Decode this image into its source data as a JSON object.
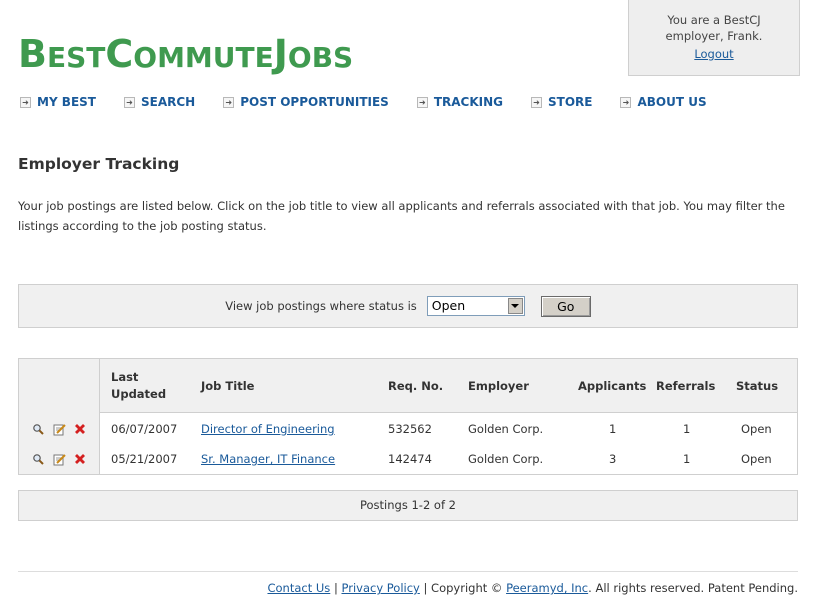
{
  "logo": {
    "text": "BestCommuteJobs"
  },
  "user_box": {
    "line1": "You are a BestCJ",
    "line2": "employer, Frank.",
    "logout": "Logout"
  },
  "nav": [
    {
      "label": "MY BEST"
    },
    {
      "label": "SEARCH"
    },
    {
      "label": "POST OPPORTUNITIES"
    },
    {
      "label": "TRACKING"
    },
    {
      "label": "STORE"
    },
    {
      "label": "ABOUT US"
    }
  ],
  "page_title": "Employer Tracking",
  "intro": "Your job postings are listed below. Click on the job title to view all applicants and referrals associated with that job. You may filter the listings according to the job posting status.",
  "filter": {
    "label": "View job postings where status is",
    "selected": "Open",
    "go": "Go"
  },
  "table": {
    "headers": {
      "last_updated_1": "Last",
      "last_updated_2": "Updated",
      "job_title": "Job Title",
      "req_no": "Req. No.",
      "employer": "Employer",
      "applicants": "Applicants",
      "referrals": "Referrals",
      "status": "Status"
    },
    "rows": [
      {
        "date": "06/07/2007",
        "title": "Director of Engineering",
        "req": "532562",
        "employer": "Golden Corp.",
        "applicants": "1",
        "referrals": "1",
        "status": "Open"
      },
      {
        "date": "05/21/2007",
        "title": "Sr. Manager, IT Finance",
        "req": "142474",
        "employer": "Golden Corp.",
        "applicants": "3",
        "referrals": "1",
        "status": "Open"
      }
    ]
  },
  "pager": "Postings 1-2 of 2",
  "footer": {
    "contact": "Contact Us",
    "sep1": "|",
    "privacy": "Privacy Policy",
    "copyright": "| Copyright ©",
    "company": "Peeramyd, Inc",
    "rest": ". All rights reserved. Patent Pending."
  },
  "colors": {
    "brand_green": "#3f9a4f",
    "link_blue": "#1a5a9a",
    "panel_gray": "#f0f0f0"
  },
  "icons": {
    "view": "magnifier-icon",
    "edit": "edit-icon",
    "delete": "delete-icon"
  }
}
